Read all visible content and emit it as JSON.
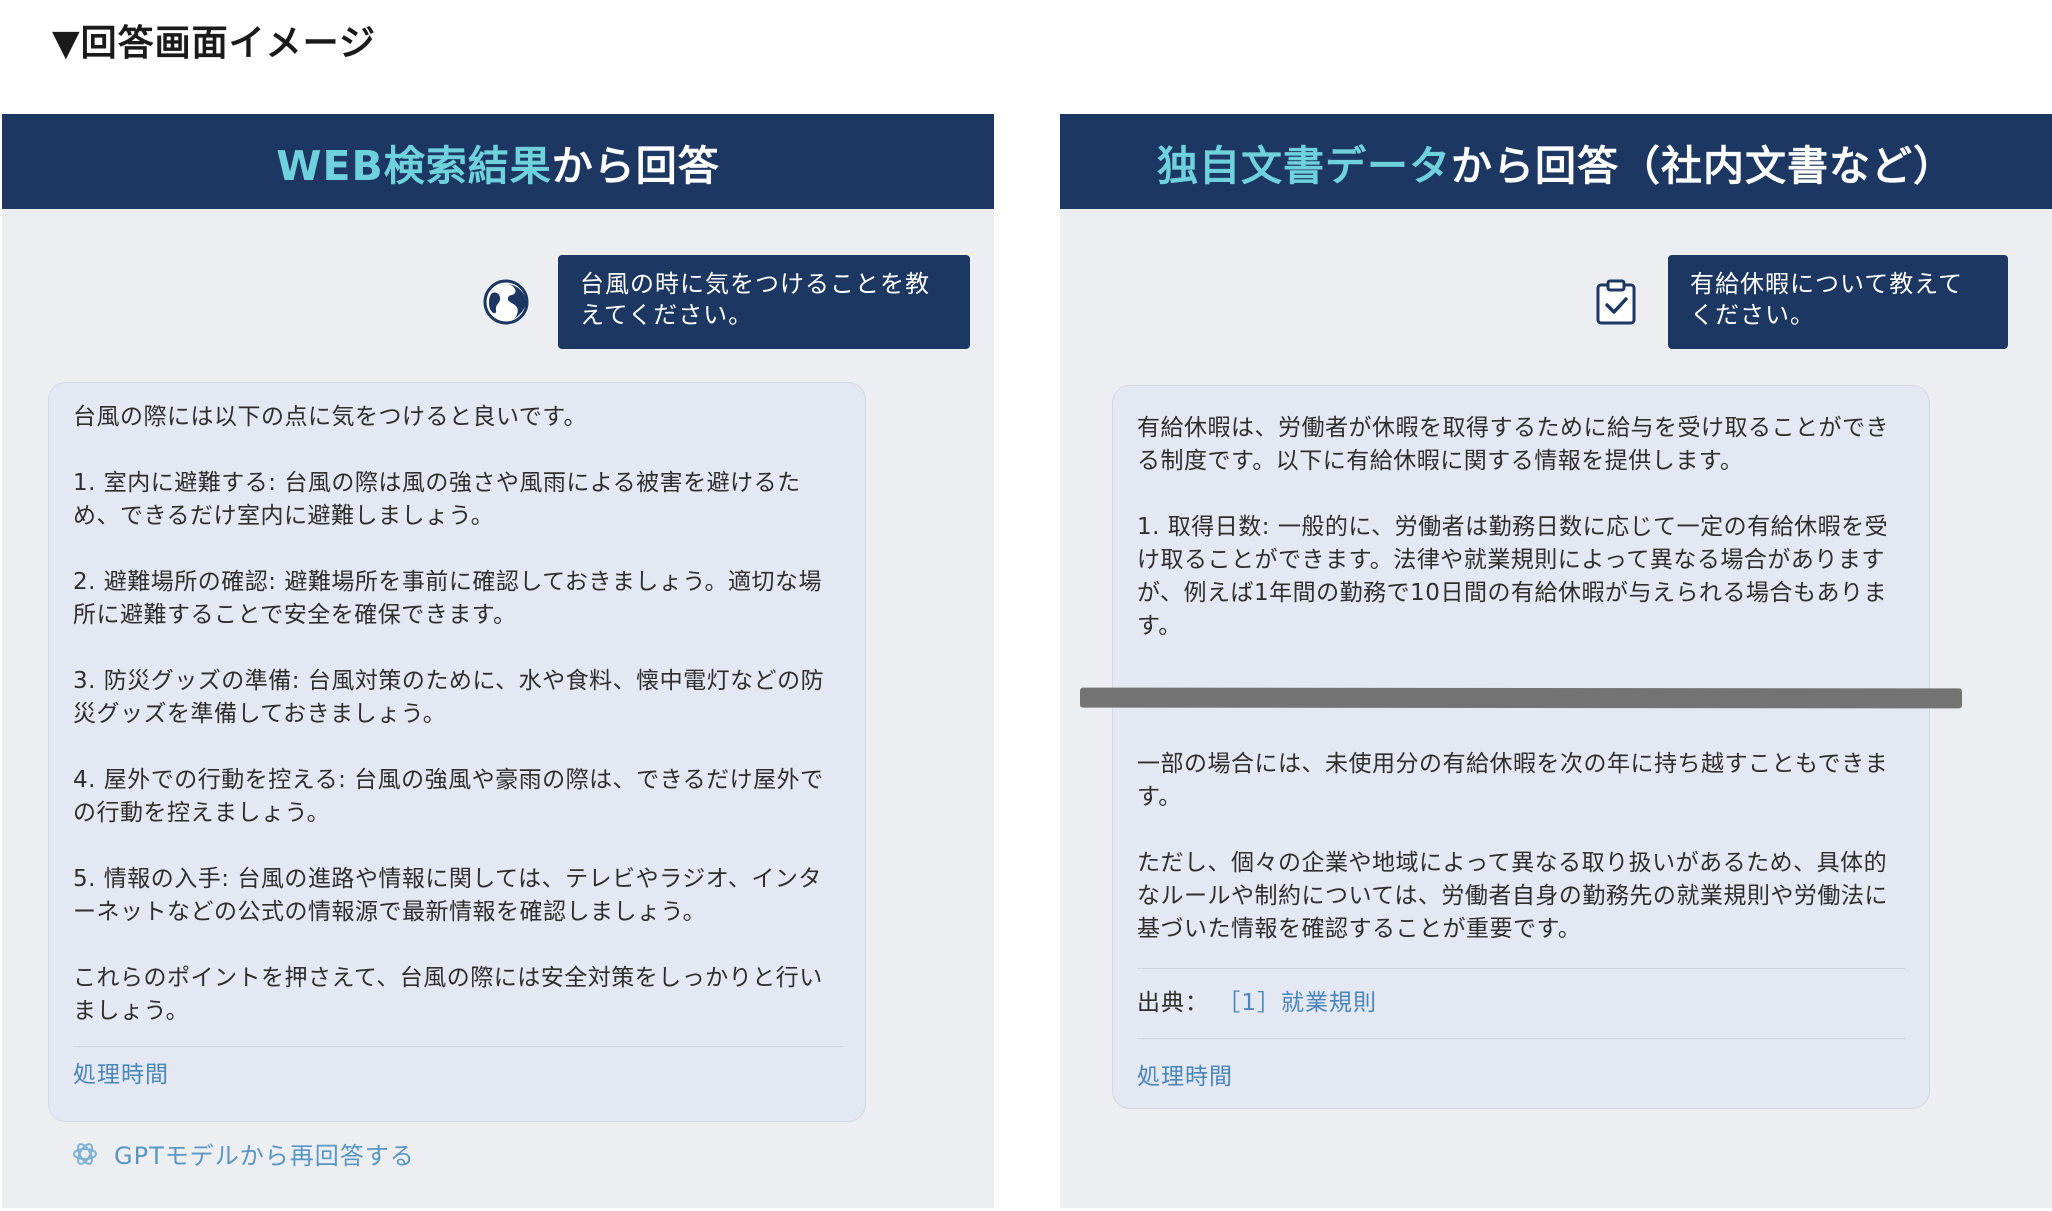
{
  "page_title": "▼回答画面イメージ",
  "left_panel": {
    "header_highlight": "WEB検索結果",
    "header_rest": "から回答",
    "user_icon": "globe-icon",
    "user_message": "台風の時に気をつけることを教えてください。",
    "answer_paragraphs": [
      "台風の際には以下の点に気をつけると良いです。",
      "1. 室内に避難する: 台風の際は風の強さや風雨による被害を避けるため、できるだけ室内に避難しましょう。",
      "2. 避難場所の確認: 避難場所を事前に確認しておきましょう。適切な場所に避難することで安全を確保できます。",
      "3. 防災グッズの準備: 台風対策のために、水や食料、懐中電灯などの防災グッズを準備しておきましょう。",
      "4. 屋外での行動を控える: 台風の強風や豪雨の際は、できるだけ屋外での行動を控えましょう。",
      "5. 情報の入手: 台風の進路や情報に関しては、テレビやラジオ、インターネットなどの公式の情報源で最新情報を確認しましょう。",
      "これらのポイントを押さえて、台風の際には安全対策をしっかりと行いましょう。"
    ],
    "processing_time": "処理時間",
    "regenerate_icon": "openai-icon",
    "regenerate_label": "GPTモデルから再回答する"
  },
  "right_panel": {
    "header_highlight": "独自文書データ",
    "header_rest": "から回答（社内文書など）",
    "user_icon": "clipboard-check-icon",
    "user_message": "有給休暇について教えてください。",
    "answer_paragraphs_top": [
      "有給休暇は、労働者が休暇を取得するために給与を受け取ることができる制度です。以下に有給休暇に関する情報を提供します。",
      "1. 取得日数: 一般的に、労働者は勤務日数に応じて一定の有給休暇を受け取ることができます。法律や就業規則によって異なる場合がありますが、例えば1年間の勤務で10日間の有給休暇が与えられる場合もあります。"
    ],
    "answer_paragraphs_bottom": [
      "一部の場合には、未使用分の有給休暇を次の年に持ち越すこともできます。",
      "ただし、個々の企業や地域によって異なる取り扱いがあるため、具体的なルールや制約については、労働者自身の勤務先の就業規則や労働法に基づいた情報を確認することが重要です。"
    ],
    "source_label": "出典：",
    "source_link": "［1］就業規則",
    "processing_time": "処理時間"
  }
}
